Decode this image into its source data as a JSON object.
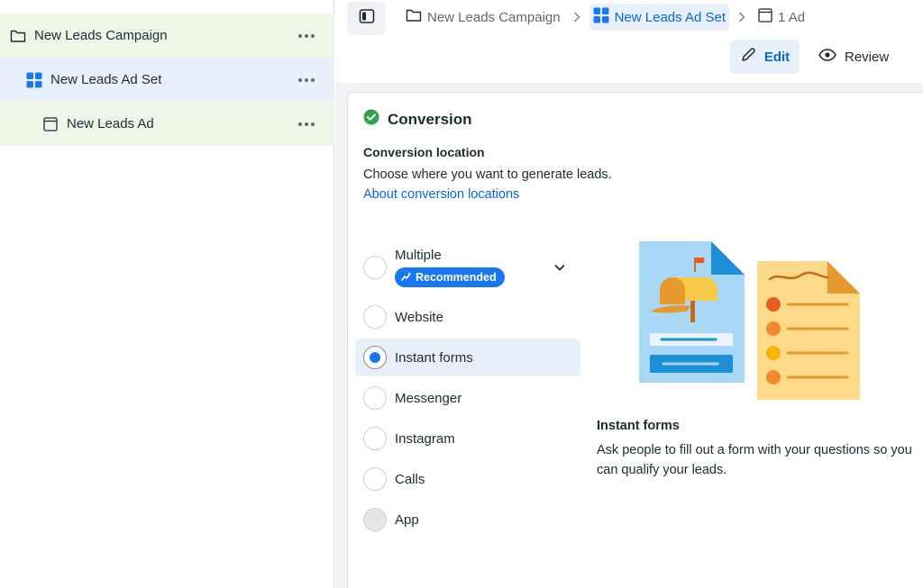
{
  "tree": {
    "campaign": "New Leads Campaign",
    "adset": "New Leads Ad Set",
    "ad": "New Leads Ad"
  },
  "breadcrumbs": {
    "campaign": "New Leads Campaign",
    "adset": "New Leads Ad Set",
    "ad": "1 Ad"
  },
  "actions": {
    "edit": "Edit",
    "review": "Review"
  },
  "conversion": {
    "heading": "Conversion",
    "location_title": "Conversion location",
    "location_desc": "Choose where you want to generate leads.",
    "location_link": "About conversion locations",
    "multiple_label": "Multiple",
    "recommended_badge": "Recommended",
    "options": [
      "Website",
      "Instant forms",
      "Messenger",
      "Instagram",
      "Calls",
      "App"
    ],
    "selected": "Instant forms",
    "info_title": "Instant forms",
    "info_desc": "Ask people to fill out a form with your questions so you can qualify your leads."
  },
  "colors": {
    "accent": "#1877f2",
    "link": "#0a66d8",
    "success": "#31a24c",
    "campaign_bg": "#eef6e8",
    "adset_bg": "#e7f0fb"
  },
  "icons": {
    "campaign": "folder-icon",
    "adset": "grid-icon",
    "ad": "ad-page-icon",
    "more": "more-dots-icon",
    "toggle": "sidebar-toggle-icon",
    "edit": "pencil-icon",
    "review": "eye-icon",
    "conversion": "check-circle-icon",
    "expand": "chevron-down-icon",
    "recommended": "sparkle-icon"
  }
}
